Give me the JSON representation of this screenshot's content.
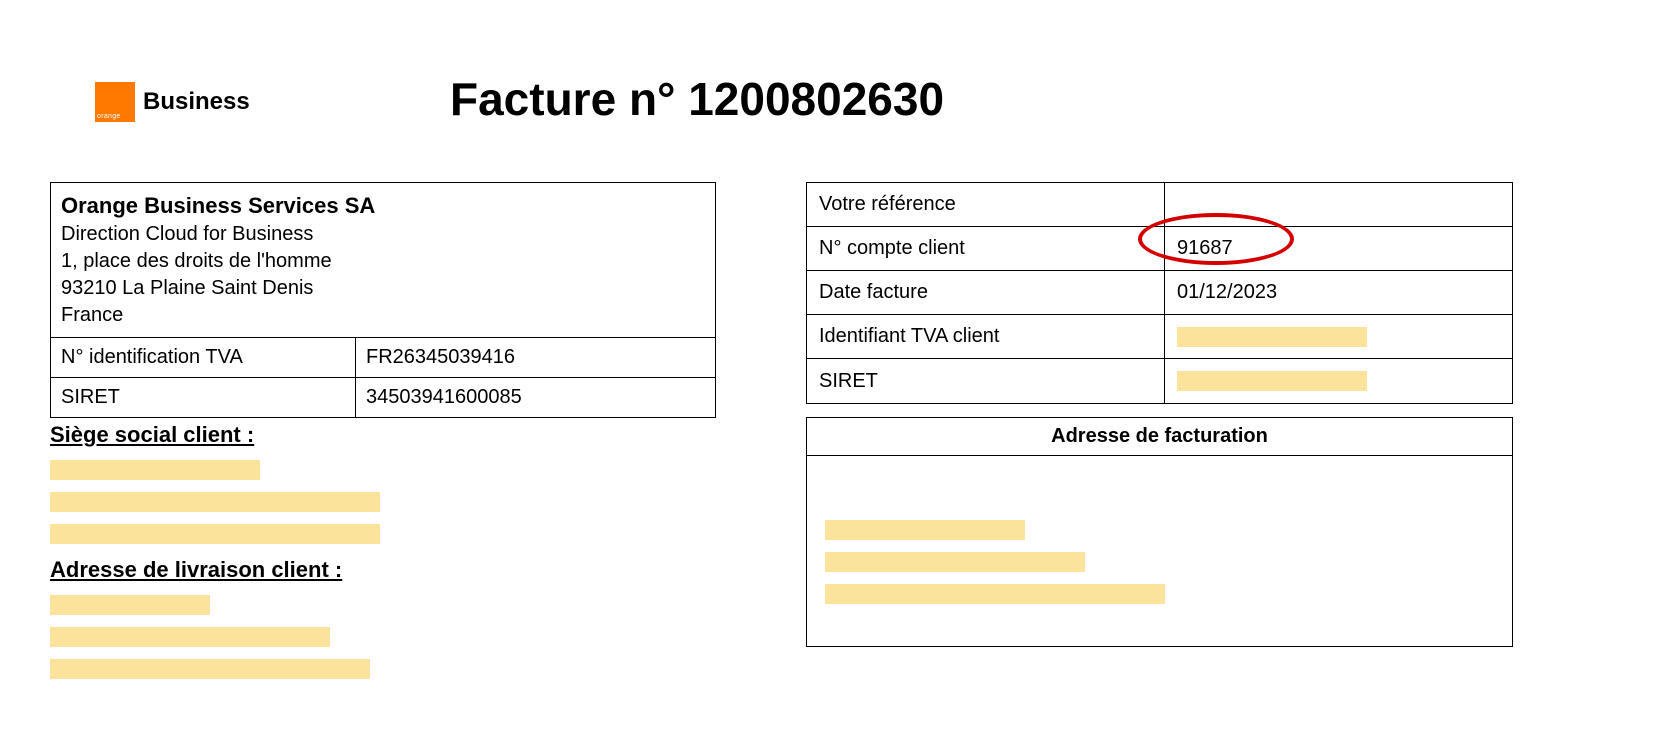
{
  "logo": {
    "brand_text": "Business"
  },
  "invoice": {
    "title": "Facture n° 1200802630"
  },
  "vendor": {
    "name": "Orange Business Services SA",
    "dept": "Direction Cloud for Business",
    "addr1": "1, place des droits de l'homme",
    "addr2": "93210 La Plaine Saint Denis",
    "country": "France",
    "vat_label": "N° identification TVA",
    "vat_value": "FR26345039416",
    "siret_label": "SIRET",
    "siret_value": "34503941600085"
  },
  "client_info": {
    "ref_label": "Votre référence",
    "ref_value": "",
    "account_label": "N° compte client",
    "account_value": "91687",
    "date_label": "Date facture",
    "date_value": "01/12/2023",
    "vat_label": "Identifiant TVA client",
    "siret_label": "SIRET"
  },
  "sections": {
    "hq_heading": "Siège social client :",
    "delivery_heading": "Adresse de livraison client :",
    "billing_heading": "Adresse de facturation"
  }
}
